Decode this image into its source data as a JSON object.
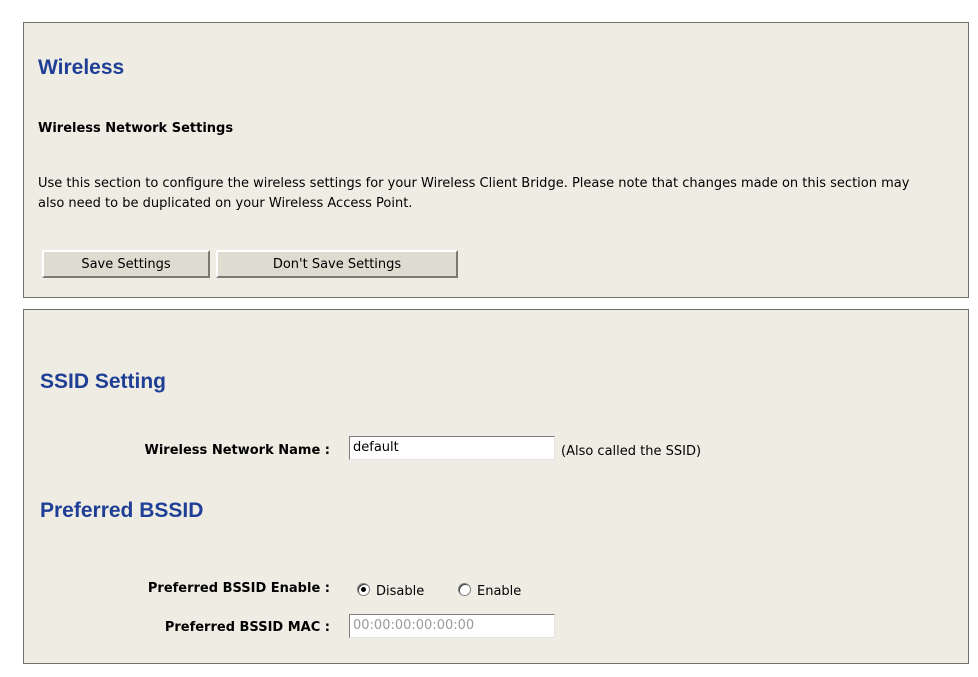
{
  "wireless": {
    "title": "Wireless",
    "subtitle": "Wireless Network Settings",
    "description": "Use this section to configure the wireless settings for your Wireless Client Bridge. Please note that changes made on this section may also need to be duplicated on your Wireless Access Point.",
    "buttons": {
      "save_label": "Save Settings",
      "dont_save_label": "Don't Save Settings"
    }
  },
  "ssid_setting": {
    "title": "SSID Setting",
    "network_name_label": "Wireless Network Name :",
    "network_name_value": "default",
    "network_name_hint": "(Also called the SSID)"
  },
  "preferred_bssid": {
    "title": "Preferred BSSID",
    "enable_label": "Preferred BSSID Enable :",
    "options": {
      "disable_label": "Disable",
      "enable_label": "Enable",
      "selected": "Disable"
    },
    "mac_label": "Preferred BSSID MAC :",
    "mac_value": "00:00:00:00:00:00"
  }
}
